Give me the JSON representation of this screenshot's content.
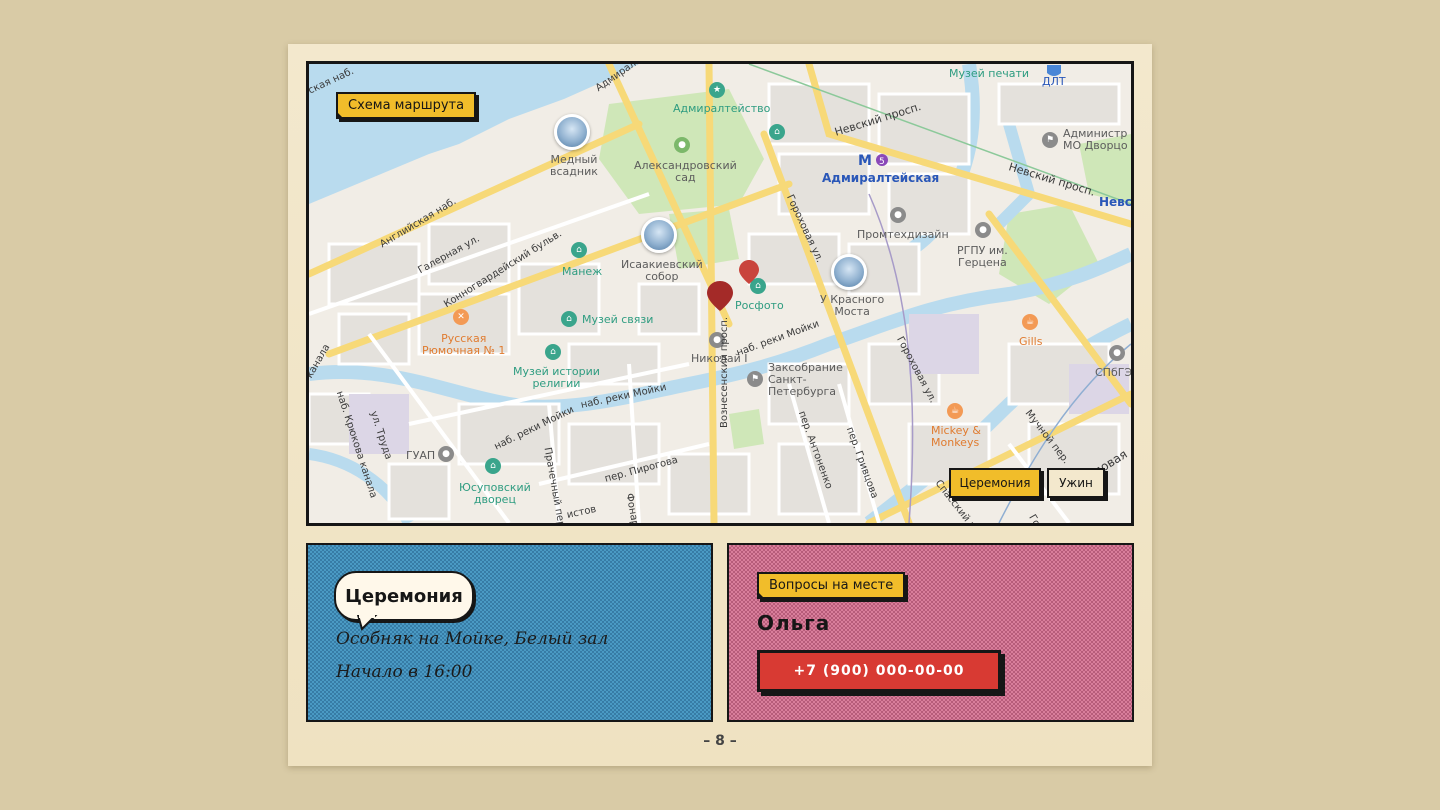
{
  "map": {
    "title_tag": "Схема маршрута",
    "buttons": {
      "ceremony": "Церемония",
      "dinner": "Ужин"
    },
    "labels": {
      "mediy_vsadnik": "Медный\nвсадник",
      "admiralteystvo": "Адмиралтейство",
      "alexandrovsky_sad": "Александровский\nсад",
      "admiralteyskaya": "Адмиралтейская",
      "isaakievsky": "Исаакиевский\nсобор",
      "manezh": "Манеж",
      "rosfoto": "Росфото",
      "krasny_most": "У Красного\nМоста",
      "promtekhdizayn": "Промтехдизайн",
      "rgpu": "РГПУ им.\nГерцена",
      "muzey_svyazi": "Музей связи",
      "ryumochnaya": "Русская\nРюмочная № 1",
      "muzey_istorii_religii": "Музей истории\nрелигии",
      "nikolay": "Николай I",
      "zakonodatelnoye": "Заксобрание\nСанкт-\nПетербурга",
      "guap": "ГУАП",
      "yusupovsky": "Юсуповский\nдворец",
      "gills": "Gills",
      "mickey": "Mickey &\nMonkeys",
      "muzey_pechati": "Музей печати",
      "dlt": "ДЛТ",
      "administration": "Администр\nМО Дворцо",
      "spbgeu": "СПбГЭ",
      "nevsk_edge": "Невс"
    },
    "streets": {
      "nevsky1": "Невский просп.",
      "nevsky2": "Невский просп.",
      "angliyskaya": "Английская наб.",
      "galernaya": "Галерная ул.",
      "konnogvardeysky": "Конногвардейский бульв.",
      "gorokhovaya1": "Гороховая ул.",
      "gorokhovaya2": "Гороховая ул.",
      "moyka1": "наб. реки Мойки",
      "moyka2": "наб. реки Мойки",
      "moyka3": "наб. реки Мойки",
      "kryukova": "наб. Крюкова канала",
      "truda": "ул. Труда",
      "pirogova": "пер. Пирогова",
      "prachechny": "Прачечный пер.",
      "voznesensky": "Вознесенский просп.",
      "antonenko": "пер. Антоненко",
      "grivtsova": "пер. Гривцова",
      "muchnoy": "Мучной пер.",
      "sadovaya": "Садовая",
      "spassky": "Спасский пер.",
      "admiralt_top": "Адмиральт",
      "kaya_nab": "ская наб.",
      "kanala": "канала",
      "fonarny": "Фонар",
      "gor_edge": "Гор",
      "istov": "истов"
    }
  },
  "ceremony_panel": {
    "bubble": "Церемония",
    "venue": "Особняк на Мойке, Белый зал",
    "time": "Начало в 16:00"
  },
  "contact_panel": {
    "tag": "Вопросы на месте",
    "name": "Ольга",
    "phone": "+7 (900) 000-00-00"
  },
  "page_number": "– 8 –",
  "colors": {
    "accent_yellow": "#f1bd2a",
    "panel_blue": "#4a9ac4",
    "panel_pink": "#d97e9b",
    "phone_red": "#d83a33",
    "pin_red": "#a42a28"
  }
}
